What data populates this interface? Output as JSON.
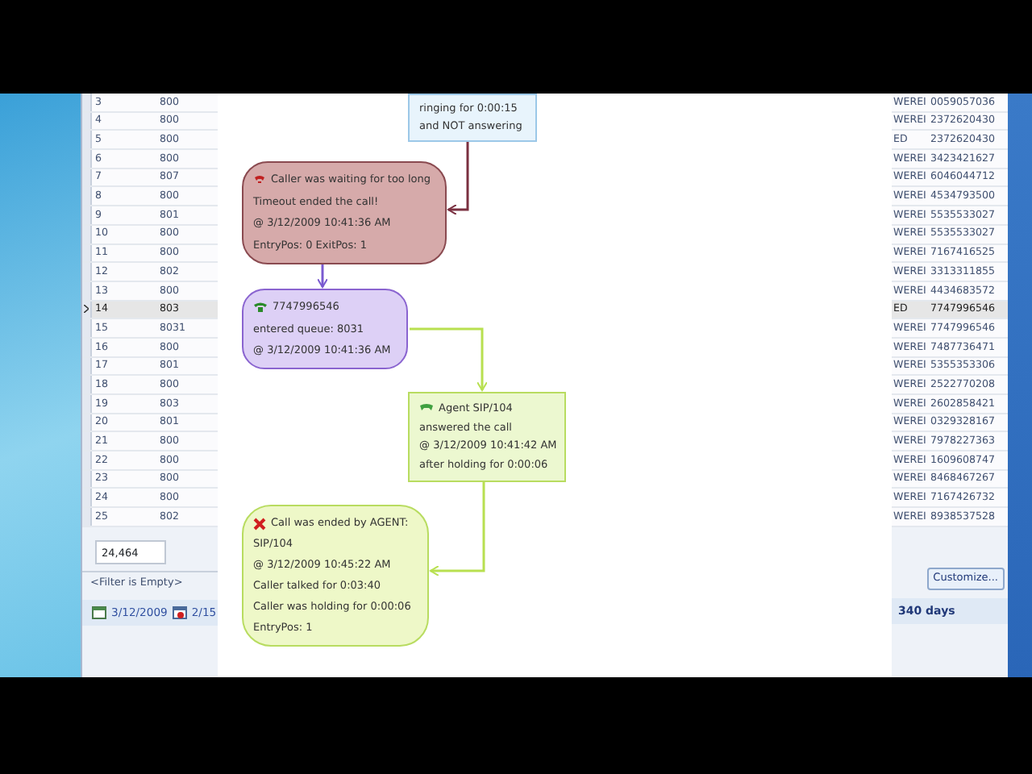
{
  "grid": {
    "rows": [
      {
        "row": "3",
        "ext": "800",
        "status": "WEREI",
        "number": "0059057036",
        "selected": false
      },
      {
        "row": "4",
        "ext": "800",
        "status": "WEREI",
        "number": "2372620430",
        "selected": false
      },
      {
        "row": "5",
        "ext": "800",
        "status": "ED",
        "number": "2372620430",
        "selected": false
      },
      {
        "row": "6",
        "ext": "800",
        "status": "WEREI",
        "number": "3423421627",
        "selected": false
      },
      {
        "row": "7",
        "ext": "807",
        "status": "WEREI",
        "number": "6046044712",
        "selected": false
      },
      {
        "row": "8",
        "ext": "800",
        "status": "WEREI",
        "number": "4534793500",
        "selected": false
      },
      {
        "row": "9",
        "ext": "801",
        "status": "WEREI",
        "number": "5535533027",
        "selected": false
      },
      {
        "row": "10",
        "ext": "800",
        "status": "WEREI",
        "number": "5535533027",
        "selected": false
      },
      {
        "row": "11",
        "ext": "800",
        "status": "WEREI",
        "number": "7167416525",
        "selected": false
      },
      {
        "row": "12",
        "ext": "802",
        "status": "WEREI",
        "number": "3313311855",
        "selected": false
      },
      {
        "row": "13",
        "ext": "800",
        "status": "WEREI",
        "number": "4434683572",
        "selected": false
      },
      {
        "row": "14",
        "ext": "803",
        "status": "ED",
        "number": "7747996546",
        "selected": true
      },
      {
        "row": "15",
        "ext": "8031",
        "status": "WEREI",
        "number": "7747996546",
        "selected": false
      },
      {
        "row": "16",
        "ext": "800",
        "status": "WEREI",
        "number": "7487736471",
        "selected": false
      },
      {
        "row": "17",
        "ext": "801",
        "status": "WEREI",
        "number": "5355353306",
        "selected": false
      },
      {
        "row": "18",
        "ext": "800",
        "status": "WEREI",
        "number": "2522770208",
        "selected": false
      },
      {
        "row": "19",
        "ext": "803",
        "status": "WEREI",
        "number": "2602858421",
        "selected": false
      },
      {
        "row": "20",
        "ext": "801",
        "status": "WEREI",
        "number": "0329328167",
        "selected": false
      },
      {
        "row": "21",
        "ext": "800",
        "status": "WEREI",
        "number": "7978227363",
        "selected": false
      },
      {
        "row": "22",
        "ext": "800",
        "status": "WEREI",
        "number": "1609608747",
        "selected": false
      },
      {
        "row": "23",
        "ext": "800",
        "status": "WEREI",
        "number": "8468467267",
        "selected": false
      },
      {
        "row": "24",
        "ext": "800",
        "status": "WEREI",
        "number": "7167426732",
        "selected": false
      },
      {
        "row": "25",
        "ext": "802",
        "status": "WEREI",
        "number": "8938537528",
        "selected": false
      }
    ],
    "total": "24,464",
    "filter": "<Filter is Empty>",
    "customize_button": "Customize..."
  },
  "status_bar": {
    "date": "3/12/2009",
    "date_2": "2/15",
    "duration": "340 days"
  },
  "diagram": {
    "nodes": [
      {
        "kind": "ringing",
        "lines": [
          "ringing for 0:00:15",
          "and NOT answering"
        ]
      },
      {
        "kind": "timeout",
        "lines": [
          "Caller was waiting for too long",
          "Timeout ended the call!",
          "@ 3/12/2009 10:41:36 AM",
          "EntryPos: 0 ExitPos: 1"
        ]
      },
      {
        "kind": "queue",
        "lines": [
          "7747996546",
          "entered queue: 8031",
          "@ 3/12/2009 10:41:36 AM"
        ]
      },
      {
        "kind": "answered",
        "lines": [
          "Agent SIP/104",
          "answered the call",
          "@ 3/12/2009 10:41:42 AM",
          "after holding for 0:00:06"
        ]
      },
      {
        "kind": "ended",
        "lines": [
          "Call was ended by AGENT:",
          "SIP/104",
          "@ 3/12/2009 10:45:22 AM",
          "Caller talked for 0:03:40",
          "Caller was holding for 0:00:06",
          "EntryPos: 1"
        ]
      }
    ]
  }
}
